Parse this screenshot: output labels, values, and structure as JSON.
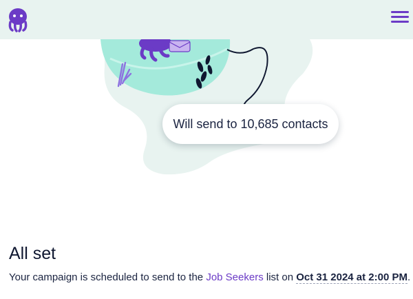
{
  "header": {
    "logo_icon": "octopus-logo-icon",
    "menu_icon": "hamburger-menu-icon"
  },
  "status": {
    "pill_text": "Will send to 10,685 contacts"
  },
  "confirmation": {
    "heading": "All set",
    "text_before": "Your campaign is scheduled to send to the ",
    "list_name": "Job Seekers",
    "text_middle": " list on ",
    "scheduled": "Oct 31 2024 at 2:00 PM",
    "text_after": "."
  },
  "colors": {
    "brand": "#6b3bc6",
    "header_bg": "#e8f3f0",
    "water": "#a4eadb",
    "blob": "#e8f3f0"
  }
}
